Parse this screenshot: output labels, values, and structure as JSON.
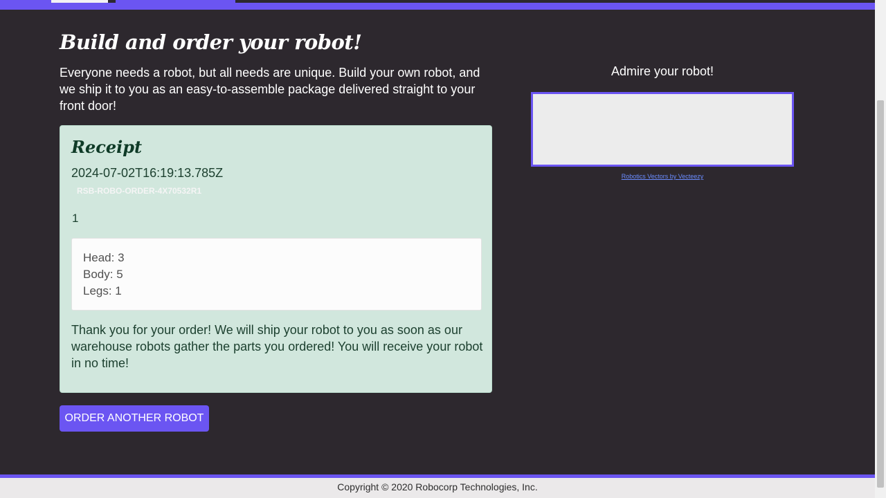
{
  "page": {
    "title": "Build and order your robot!",
    "intro": "Everyone needs a robot, but all needs are unique. Build your own robot, and we ship it to you as an easy-to-assemble package delivered straight to your front door!"
  },
  "receipt": {
    "heading": "Receipt",
    "timestamp": "2024-07-02T16:19:13.785Z",
    "order_id": "RSB-ROBO-ORDER-4X70532R1",
    "address": "1",
    "parts": [
      "Head: 3",
      "Body: 5",
      "Legs: 1"
    ],
    "thanks": "Thank you for your order! We will ship your robot to you as soon as our warehouse robots gather the parts you ordered! You will receive your robot in no time!"
  },
  "actions": {
    "order_another_label": "ORDER ANOTHER ROBOT"
  },
  "preview": {
    "label": "Admire your robot!",
    "credit": "Robotics Vectors by Vecteezy"
  },
  "footer": {
    "copyright": "Copyright © 2020 Robocorp Technologies, Inc."
  },
  "colors": {
    "background": "#2d282e",
    "accent": "#6b55f2",
    "receipt_bg": "#d1e7dd"
  }
}
